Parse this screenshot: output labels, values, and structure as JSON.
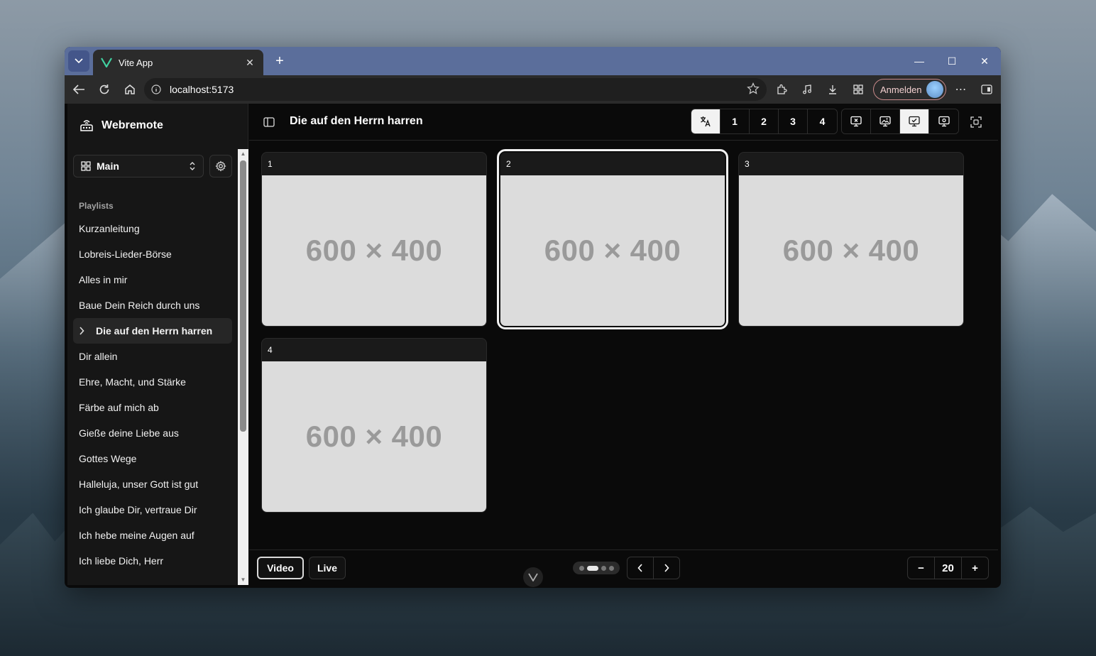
{
  "browser": {
    "tab_title": "Vite App",
    "url": "localhost:5173",
    "signin_label": "Anmelden"
  },
  "app": {
    "brand": "Webremote",
    "workspace": "Main",
    "playlists_header": "Playlists",
    "playlists": [
      "Kurzanleitung",
      "Lobreis-Lieder-Börse",
      "Alles in mir",
      "Baue Dein Reich durch uns",
      "Die auf den Herrn harren",
      "Dir allein",
      "Ehre, Macht, und Stärke",
      "Färbe auf mich ab",
      "Gieße deine Liebe aus",
      "Gottes Wege",
      "Halleluja, unser Gott ist gut",
      "Ich glaube Dir, vertraue Dir",
      "Ich hebe meine Augen auf",
      "Ich liebe Dich, Herr"
    ],
    "active_playlist_index": 4,
    "title": "Die auf den Herrn harren",
    "language_buttons": [
      "1",
      "2",
      "3",
      "4"
    ],
    "slides": [
      {
        "label": "1",
        "placeholder": "600 × 400"
      },
      {
        "label": "2",
        "placeholder": "600 × 400"
      },
      {
        "label": "3",
        "placeholder": "600 × 400"
      },
      {
        "label": "4",
        "placeholder": "600 × 400"
      }
    ],
    "selected_slide_index": 1,
    "footer": {
      "video_label": "Video",
      "live_label": "Live",
      "zoom_value": "20",
      "zoom_minus": "−",
      "zoom_plus": "+"
    }
  }
}
